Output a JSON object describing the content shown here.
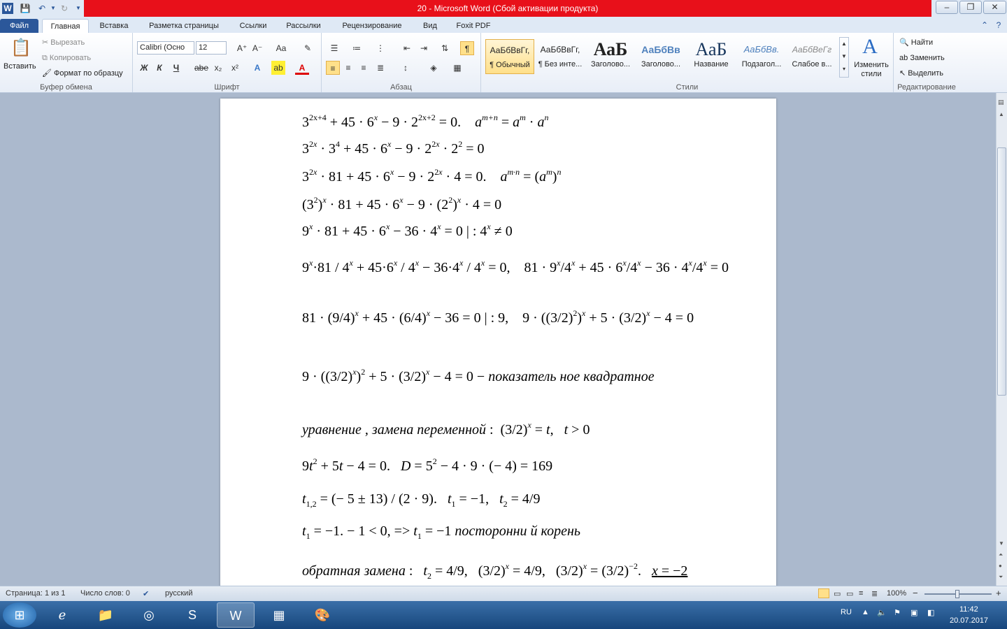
{
  "window": {
    "title": "20  -  Microsoft Word (Сбой активации продукта)",
    "minimize": "–",
    "restore": "❐",
    "close": "✕"
  },
  "tabs": [
    {
      "label": "Файл"
    },
    {
      "label": "Главная"
    },
    {
      "label": "Вставка"
    },
    {
      "label": "Разметка страницы"
    },
    {
      "label": "Ссылки"
    },
    {
      "label": "Рассылки"
    },
    {
      "label": "Рецензирование"
    },
    {
      "label": "Вид"
    },
    {
      "label": "Foxit PDF"
    }
  ],
  "ribbon": {
    "clipboard": {
      "paste": "Вставить",
      "cut": "Вырезать",
      "copy": "Копировать",
      "format_painter": "Формат по образцу",
      "label": "Буфер обмена"
    },
    "font": {
      "name": "Calibri (Осно",
      "size": "12",
      "label": "Шрифт",
      "bold": "Ж",
      "italic": "К",
      "underline": "Ч",
      "strike": "abe",
      "sub": "x₂",
      "sup": "x²",
      "grow": "A⁺",
      "shrink": "A⁻",
      "case": "Aa"
    },
    "paragraph": {
      "label": "Абзац",
      "pilcrow": "¶"
    },
    "styles": {
      "label": "Стили",
      "items": [
        {
          "preview": "АаБбВвГг,",
          "name": "¶ Обычный"
        },
        {
          "preview": "АаБбВвГг,",
          "name": "¶ Без инте..."
        },
        {
          "preview": "АаБ",
          "name": "Заголово..."
        },
        {
          "preview": "АаБбВв",
          "name": "Заголово..."
        },
        {
          "preview": "АаБ",
          "name": "Название"
        },
        {
          "preview": "АаБбВв.",
          "name": "Подзагол..."
        },
        {
          "preview": "АаБбВеГг",
          "name": "Слабое в..."
        }
      ],
      "change": "Изменить стили"
    },
    "editing": {
      "find": "Найти",
      "replace": "Заменить",
      "select": "Выделить",
      "label": "Редактирование"
    }
  },
  "document": {
    "lines": [
      "3<sup>2x+4</sup> + 45 · 6<sup><i>x</i></sup> − 9 · 2<sup>2x+2</sup> = 0.&nbsp;&nbsp;&nbsp; <i>a</i><sup><i>m+n</i></sup> = <i>a</i><sup><i>m</i></sup> · <i>a</i><sup><i>n</i></sup>",
      "3<sup>2<i>x</i></sup> · 3<sup>4</sup> + 45 · 6<sup><i>x</i></sup> − 9 · 2<sup>2<i>x</i></sup> · 2<sup>2</sup> = 0",
      "3<sup>2<i>x</i></sup> · 81 + 45 · 6<sup><i>x</i></sup> − 9 · 2<sup>2<i>x</i></sup> · 4 = 0.&nbsp;&nbsp;&nbsp; <i>a</i><sup><i>m·n</i></sup> = (<i>a</i><sup><i>m</i></sup>)<sup><i>n</i></sup>",
      "(3<sup>2</sup>)<sup><i>x</i></sup> · 81 + 45 · 6<sup><i>x</i></sup> − 9 · (2<sup>2</sup>)<sup><i>x</i></sup> · 4 = 0",
      "9<sup><i>x</i></sup> · 81 + 45 · 6<sup><i>x</i></sup> − 36 · 4<sup><i>x</i></sup> = 0 | : 4<sup><i>x</i></sup> ≠ 0",
      "9<sup><i>x</i></sup>·81 / 4<sup><i>x</i></sup> + 45·6<sup><i>x</i></sup> / 4<sup><i>x</i></sup> − 36·4<sup><i>x</i></sup> / 4<sup><i>x</i></sup> = 0,&nbsp;&nbsp;&nbsp; 81 · 9<sup><i>x</i></sup>/4<sup><i>x</i></sup> + 45 · 6<sup><i>x</i></sup>/4<sup><i>x</i></sup> − 36 · 4<sup><i>x</i></sup>/4<sup><i>x</i></sup> = 0",
      "81 · (9/4)<sup><i>x</i></sup> + 45 · (6/4)<sup><i>x</i></sup> − 36 = 0 | : 9,&nbsp;&nbsp;&nbsp; 9 · ((3/2)<sup>2</sup>)<sup><i>x</i></sup> + 5 · (3/2)<sup><i>x</i></sup> − 4 = 0",
      "9 · ((3/2)<sup><i>x</i></sup>)<sup>2</sup> + 5 · (3/2)<sup><i>x</i></sup> − 4 = 0 − <i>показатель ное квадратное</i>",
      "<i>уравнение , замена переменной</i> : &nbsp;(3/2)<sup><i>x</i></sup> = <i>t</i>,&nbsp;&nbsp; <i>t</i> &gt; 0",
      "9<i>t</i><sup>2</sup> + 5<i>t</i> − 4 = 0.&nbsp;&nbsp; <i>D</i> = 5<sup>2</sup> − 4 · 9 · (− 4) = 169",
      "<i>t</i><sub>1,2</sub> = (− 5 ± 13) / (2 · 9).&nbsp;&nbsp; <i>t</i><sub>1</sub> = −1,&nbsp;&nbsp; <i>t</i><sub>2</sub> = 4/9",
      "<i>t</i><sub>1</sub> = −1. − 1 &lt; 0, =&gt; <i>t</i><sub>1</sub> = −1 <i>посторонни й корень</i>",
      "<i>обратная замена</i> :&nbsp;&nbsp; <i>t</i><sub>2</sub> = 4/9,&nbsp;&nbsp; (3/2)<sup><i>x</i></sup> = 4/9,&nbsp;&nbsp; (3/2)<sup><i>x</i></sup> = (3/2)<sup>−2</sup>.&nbsp;&nbsp; <u><i>x</i> = −2</u>"
    ]
  },
  "statusbar": {
    "page": "Страница: 1 из 1",
    "words": "Число слов: 0",
    "lang": "русский",
    "zoom": "100%",
    "zoom_minus": "−",
    "zoom_plus": "+"
  },
  "taskbar": {
    "lang": "RU",
    "time": "11:42",
    "date": "20.07.2017"
  }
}
